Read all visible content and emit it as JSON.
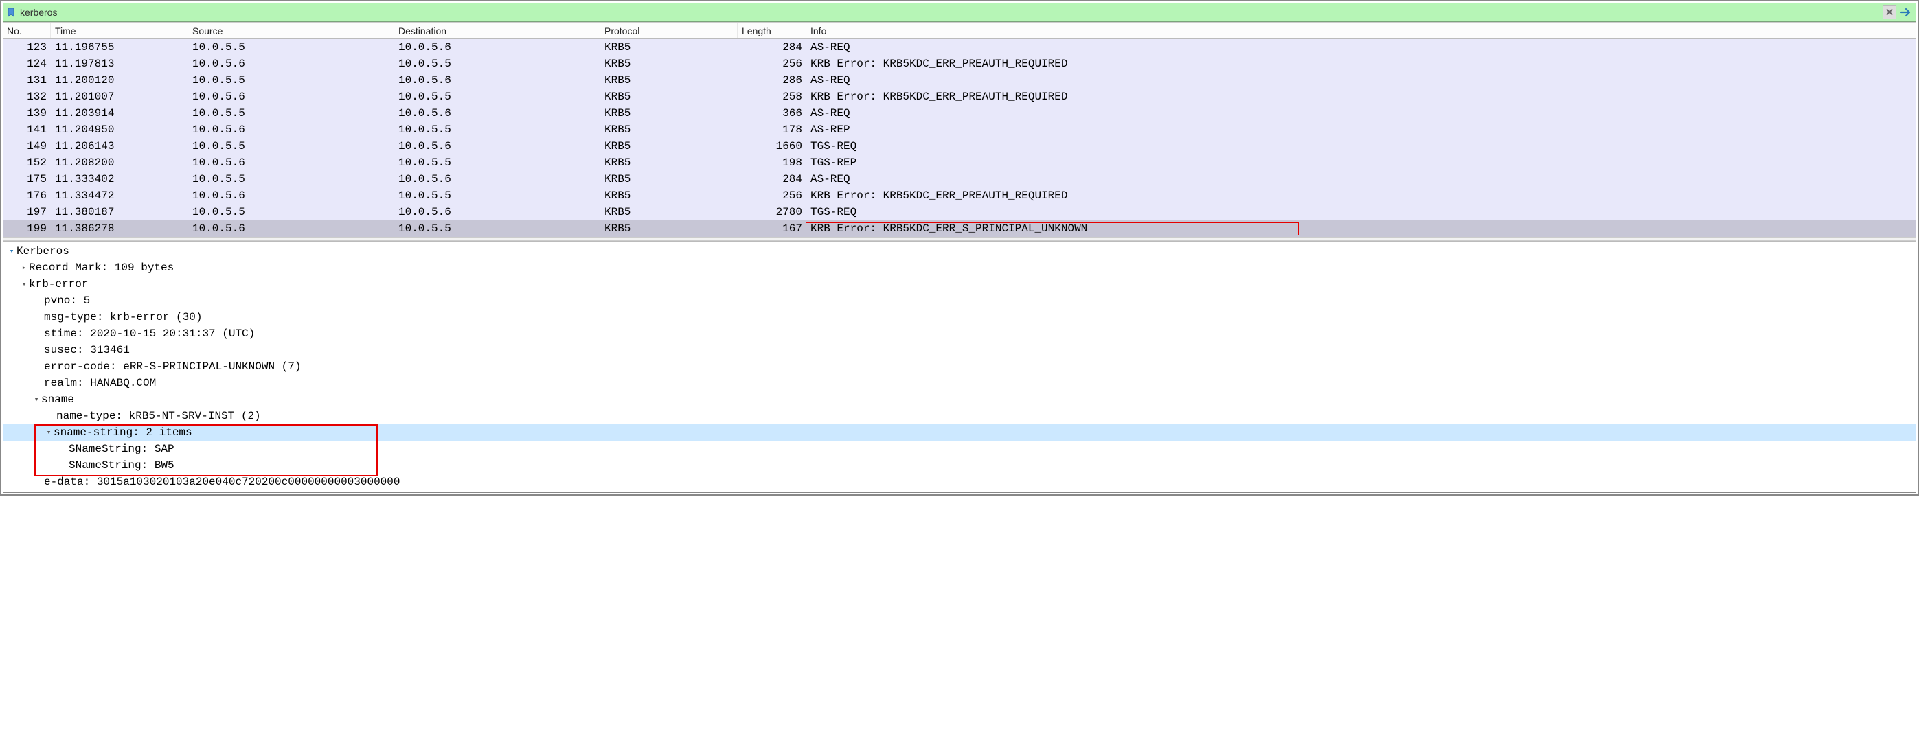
{
  "filter": {
    "value": "kerberos"
  },
  "columns": [
    "No.",
    "Time",
    "Source",
    "Destination",
    "Protocol",
    "Length",
    "Info"
  ],
  "packets": [
    {
      "no": "123",
      "time": "11.196755",
      "src": "10.0.5.5",
      "dst": "10.0.5.6",
      "proto": "KRB5",
      "len": "284",
      "info": "AS-REQ"
    },
    {
      "no": "124",
      "time": "11.197813",
      "src": "10.0.5.6",
      "dst": "10.0.5.5",
      "proto": "KRB5",
      "len": "256",
      "info": "KRB Error: KRB5KDC_ERR_PREAUTH_REQUIRED"
    },
    {
      "no": "131",
      "time": "11.200120",
      "src": "10.0.5.5",
      "dst": "10.0.5.6",
      "proto": "KRB5",
      "len": "286",
      "info": "AS-REQ"
    },
    {
      "no": "132",
      "time": "11.201007",
      "src": "10.0.5.6",
      "dst": "10.0.5.5",
      "proto": "KRB5",
      "len": "258",
      "info": "KRB Error: KRB5KDC_ERR_PREAUTH_REQUIRED"
    },
    {
      "no": "139",
      "time": "11.203914",
      "src": "10.0.5.5",
      "dst": "10.0.5.6",
      "proto": "KRB5",
      "len": "366",
      "info": "AS-REQ"
    },
    {
      "no": "141",
      "time": "11.204950",
      "src": "10.0.5.6",
      "dst": "10.0.5.5",
      "proto": "KRB5",
      "len": "178",
      "info": "AS-REP"
    },
    {
      "no": "149",
      "time": "11.206143",
      "src": "10.0.5.5",
      "dst": "10.0.5.6",
      "proto": "KRB5",
      "len": "1660",
      "info": "TGS-REQ"
    },
    {
      "no": "152",
      "time": "11.208200",
      "src": "10.0.5.6",
      "dst": "10.0.5.5",
      "proto": "KRB5",
      "len": "198",
      "info": "TGS-REP"
    },
    {
      "no": "175",
      "time": "11.333402",
      "src": "10.0.5.5",
      "dst": "10.0.5.6",
      "proto": "KRB5",
      "len": "284",
      "info": "AS-REQ"
    },
    {
      "no": "176",
      "time": "11.334472",
      "src": "10.0.5.6",
      "dst": "10.0.5.5",
      "proto": "KRB5",
      "len": "256",
      "info": "KRB Error: KRB5KDC_ERR_PREAUTH_REQUIRED"
    },
    {
      "no": "197",
      "time": "11.380187",
      "src": "10.0.5.5",
      "dst": "10.0.5.6",
      "proto": "KRB5",
      "len": "2780",
      "info": "TGS-REQ"
    },
    {
      "no": "199",
      "time": "11.386278",
      "src": "10.0.5.6",
      "dst": "10.0.5.5",
      "proto": "KRB5",
      "len": "167",
      "info": "KRB Error: KRB5KDC_ERR_S_PRINCIPAL_UNKNOWN",
      "selected": true,
      "highlight": true
    }
  ],
  "details": {
    "root": "Kerberos",
    "record_mark": "Record Mark: 109 bytes",
    "krb_error_label": "krb-error",
    "pvno": "pvno: 5",
    "msg_type": "msg-type: krb-error (30)",
    "stime": "stime: 2020-10-15 20:31:37 (UTC)",
    "susec": "susec: 313461",
    "error_code": "error-code: eRR-S-PRINCIPAL-UNKNOWN (7)",
    "realm": "realm: HANABQ.COM",
    "sname_label": "sname",
    "name_type": "name-type: kRB5-NT-SRV-INST (2)",
    "sname_string_label": "sname-string: 2 items",
    "sname_string_0": "SNameString: SAP",
    "sname_string_1": "SNameString: BW5",
    "e_data": "e-data: 3015a103020103a20e040c720200c00000000003000000"
  }
}
